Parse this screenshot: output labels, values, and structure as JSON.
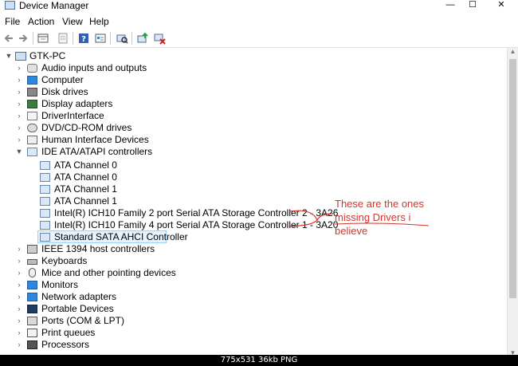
{
  "window": {
    "title": "Device Manager",
    "minimize": "—",
    "maximize": "☐",
    "close": "✕"
  },
  "menu": [
    "File",
    "Action",
    "View",
    "Help"
  ],
  "toolbar": [
    "back-arrow",
    "forward-arrow",
    "properties",
    "show-hidden",
    "help",
    "show-view",
    "scan-hardware",
    "update-driver",
    "uninstall-device"
  ],
  "tree": {
    "root": "GTK-PC",
    "categories_top": [
      "Audio inputs and outputs",
      "Computer",
      "Disk drives",
      "Display adapters",
      "DriverInterface",
      "DVD/CD-ROM drives",
      "Human Interface Devices"
    ],
    "expanded_category": "IDE ATA/ATAPI controllers",
    "children": [
      "ATA Channel 0",
      "ATA Channel 0",
      "ATA Channel 1",
      "ATA Channel 1",
      "Intel(R) ICH10 Family 2 port Serial ATA Storage Controller 2 - 3A26",
      "Intel(R) ICH10 Family 4 port Serial ATA Storage Controller 1 - 3A20",
      "Standard SATA AHCI Controller"
    ],
    "categories_bottom": [
      "IEEE 1394 host controllers",
      "Keyboards",
      "Mice and other pointing devices",
      "Monitors",
      "Network adapters",
      "Portable Devices",
      "Ports (COM & LPT)",
      "Print queues",
      "Processors"
    ]
  },
  "annotation": {
    "line1": "These are the ones",
    "line2": "missing Drivers i",
    "line3": "believe"
  },
  "footer": "775x531  36kb  PNG",
  "colors": {
    "annotation": "#d4342c",
    "selection": "#e5f3ff"
  }
}
